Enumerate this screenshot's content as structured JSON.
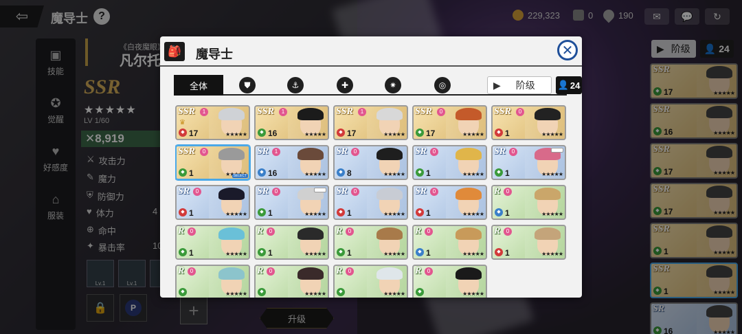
{
  "topbar": {
    "title": "魔导士",
    "help": "?",
    "gold": "229,323",
    "stones": "0",
    "drops": "190"
  },
  "left_nav": [
    {
      "label": "技能",
      "icon": "skill-icon"
    },
    {
      "label": "觉醒",
      "icon": "awaken-icon"
    },
    {
      "label": "好感度",
      "icon": "affinity-icon"
    },
    {
      "label": "服装",
      "icon": "costume-icon"
    }
  ],
  "character": {
    "subtitle": "《白夜魔眼》",
    "name": "凡尔托",
    "rarity": "SSR",
    "stars": "★★★★★",
    "level": "LV 1/60",
    "power": "8,919",
    "stats": [
      {
        "label": "攻击力",
        "value": ""
      },
      {
        "label": "魔力",
        "value": ""
      },
      {
        "label": "防御力",
        "value": ""
      },
      {
        "label": "体力",
        "value": "4"
      },
      {
        "label": "命中",
        "value": ""
      },
      {
        "label": "暴击率",
        "value": "10"
      }
    ],
    "skills": [
      "Lv.1",
      "Lv.1",
      "Lv"
    ],
    "enhance_label": "升级"
  },
  "right_panel": {
    "sort_label": "阶级",
    "count": "24",
    "cards": [
      {
        "rarity": "SSR",
        "level": "17",
        "selected": false
      },
      {
        "rarity": "SSR",
        "level": "16",
        "selected": false
      },
      {
        "rarity": "SSR",
        "level": "17",
        "selected": false
      },
      {
        "rarity": "SSR",
        "level": "17",
        "selected": false
      },
      {
        "rarity": "SSR",
        "level": "1",
        "selected": false
      },
      {
        "rarity": "SSR",
        "level": "1",
        "selected": true
      },
      {
        "rarity": "SR",
        "level": "16",
        "selected": false
      }
    ]
  },
  "modal": {
    "title": "魔导士",
    "tab_all": "全体",
    "sort_label": "阶级",
    "count": "24",
    "select_tag": "SELECT",
    "colors": {
      "select_border": "#4aa8e8",
      "close_blue": "#1f4f99",
      "awaken_pink": "#e2568f"
    },
    "cards": [
      {
        "rarity": "SSR",
        "awaken": "1",
        "level": "17",
        "attr": "#d23a3a",
        "crown": true,
        "hair": "#cfd2d6",
        "selected": false,
        "badge": false
      },
      {
        "rarity": "SSR",
        "awaken": "1",
        "level": "16",
        "attr": "#3a9a3a",
        "crown": false,
        "hair": "#1b1b1b",
        "selected": false,
        "badge": false
      },
      {
        "rarity": "SSR",
        "awaken": "1",
        "level": "17",
        "attr": "#d23a3a",
        "crown": false,
        "hair": "#d8d8d8",
        "selected": false,
        "badge": false
      },
      {
        "rarity": "SSR",
        "awaken": "0",
        "level": "17",
        "attr": "#3a9a3a",
        "crown": false,
        "hair": "#c45a2a",
        "selected": false,
        "badge": false
      },
      {
        "rarity": "SSR",
        "awaken": "0",
        "level": "1",
        "attr": "#d23a3a",
        "crown": false,
        "hair": "#222222",
        "selected": false,
        "badge": false
      },
      {
        "rarity": "SSR",
        "awaken": "0",
        "level": "1",
        "attr": "#3a9a3a",
        "crown": false,
        "hair": "#9a9a9a",
        "selected": true,
        "badge": false
      },
      {
        "rarity": "SR",
        "awaken": "1",
        "level": "16",
        "attr": "#3a7fc9",
        "crown": false,
        "hair": "#6a4a3a",
        "selected": false,
        "badge": false
      },
      {
        "rarity": "SR",
        "awaken": "0",
        "level": "8",
        "attr": "#3a7fc9",
        "crown": false,
        "hair": "#1e1e1e",
        "selected": false,
        "badge": false
      },
      {
        "rarity": "SR",
        "awaken": "0",
        "level": "1",
        "attr": "#3a9a3a",
        "crown": false,
        "hair": "#e0b54a",
        "selected": false,
        "badge": false
      },
      {
        "rarity": "SR",
        "awaken": "0",
        "level": "1",
        "attr": "#3a9a3a",
        "crown": false,
        "hair": "#d86a8a",
        "selected": false,
        "badge": true
      },
      {
        "rarity": "SR",
        "awaken": "0",
        "level": "1",
        "attr": "#d23a3a",
        "crown": false,
        "hair": "#1a1a2a",
        "selected": false,
        "badge": false
      },
      {
        "rarity": "SR",
        "awaken": "0",
        "level": "1",
        "attr": "#3a9a3a",
        "crown": false,
        "hair": "#d0d0d0",
        "selected": false,
        "badge": true
      },
      {
        "rarity": "SR",
        "awaken": "0",
        "level": "1",
        "attr": "#d23a3a",
        "crown": false,
        "hair": "#c8ccd4",
        "selected": false,
        "badge": false
      },
      {
        "rarity": "SR",
        "awaken": "0",
        "level": "1",
        "attr": "#d23a3a",
        "crown": false,
        "hair": "#e08a3a",
        "selected": false,
        "badge": false
      },
      {
        "rarity": "R",
        "awaken": "0",
        "level": "1",
        "attr": "#3a7fc9",
        "crown": false,
        "hair": "#caa66a",
        "selected": false,
        "badge": false
      },
      {
        "rarity": "R",
        "awaken": "0",
        "level": "1",
        "attr": "#3a9a3a",
        "crown": false,
        "hair": "#6ac0d8",
        "selected": false,
        "badge": false
      },
      {
        "rarity": "R",
        "awaken": "0",
        "level": "1",
        "attr": "#3a9a3a",
        "crown": false,
        "hair": "#2a2a2a",
        "selected": false,
        "badge": false
      },
      {
        "rarity": "R",
        "awaken": "0",
        "level": "1",
        "attr": "#3a9a3a",
        "crown": false,
        "hair": "#a87a4a",
        "selected": false,
        "badge": false
      },
      {
        "rarity": "R",
        "awaken": "0",
        "level": "1",
        "attr": "#3a7fc9",
        "crown": false,
        "hair": "#c89a5a",
        "selected": false,
        "badge": false
      },
      {
        "rarity": "R",
        "awaken": "0",
        "level": "1",
        "attr": "#d23a3a",
        "crown": false,
        "hair": "#c4a47a",
        "selected": false,
        "badge": false
      },
      {
        "rarity": "R",
        "awaken": "0",
        "level": "",
        "attr": "#3a9a3a",
        "crown": false,
        "hair": "#8cc4cc",
        "selected": false,
        "badge": false
      },
      {
        "rarity": "R",
        "awaken": "0",
        "level": "",
        "attr": "#3a9a3a",
        "crown": false,
        "hair": "#3a2a2a",
        "selected": false,
        "badge": false
      },
      {
        "rarity": "R",
        "awaken": "0",
        "level": "",
        "attr": "#3a9a3a",
        "crown": false,
        "hair": "#dfe6ea",
        "selected": false,
        "badge": false
      },
      {
        "rarity": "R",
        "awaken": "0",
        "level": "",
        "attr": "#3a9a3a",
        "crown": false,
        "hair": "#1a1a1a",
        "selected": false,
        "badge": false
      }
    ],
    "stars": "★★★★★"
  }
}
